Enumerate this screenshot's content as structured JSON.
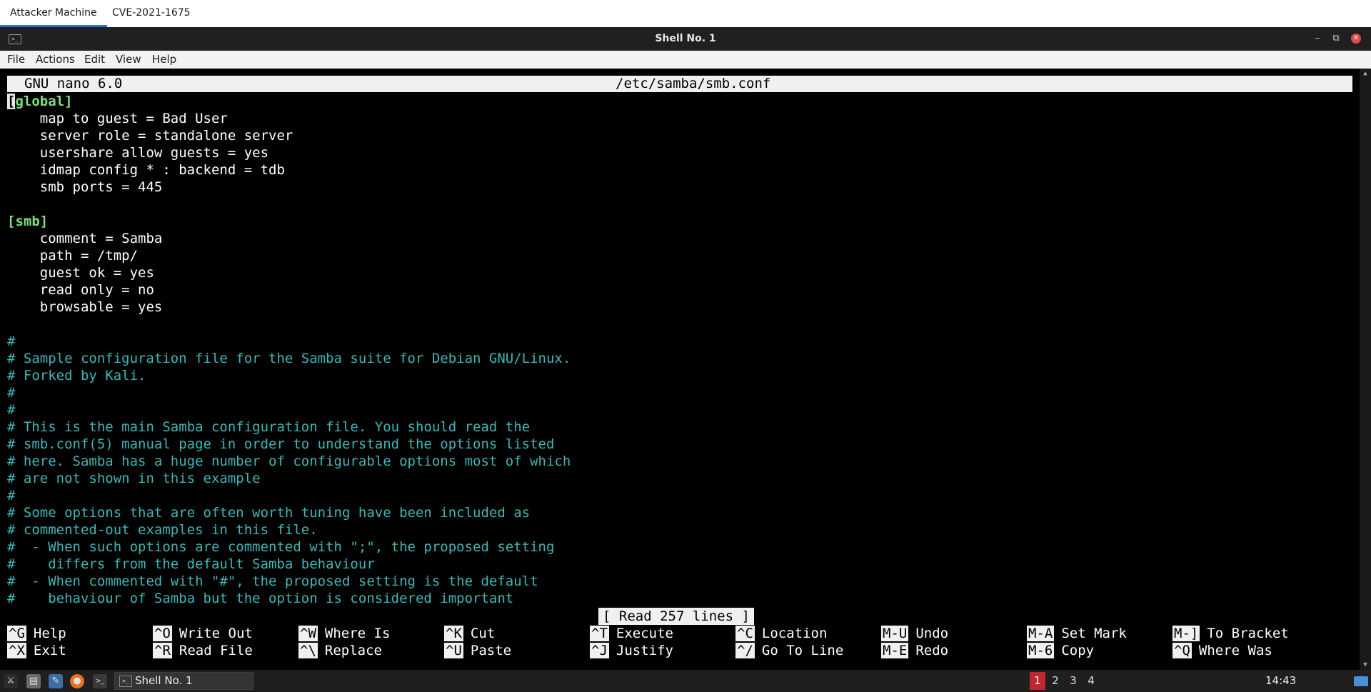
{
  "top_tabs": [
    {
      "label": "Attacker Machine",
      "active": true
    },
    {
      "label": "CVE-2021-1675",
      "active": false
    }
  ],
  "window": {
    "title": "Shell No. 1",
    "icon": "terminal-icon",
    "controls": {
      "minimize": "–",
      "restore": "⧉",
      "close": "✕"
    }
  },
  "menu": [
    "File",
    "Actions",
    "Edit",
    "View",
    "Help"
  ],
  "nano": {
    "app": "GNU nano 6.0",
    "file": "/etc/samba/smb.conf",
    "status": "[ Read 257 lines ]",
    "lines": [
      {
        "text": "[global]",
        "kind": "section"
      },
      {
        "text": "    map to guest = Bad User",
        "kind": "normal"
      },
      {
        "text": "    server role = standalone server",
        "kind": "normal"
      },
      {
        "text": "    usershare allow guests = yes",
        "kind": "normal"
      },
      {
        "text": "    idmap config * : backend = tdb",
        "kind": "normal"
      },
      {
        "text": "    smb ports = 445",
        "kind": "normal"
      },
      {
        "text": "",
        "kind": "normal"
      },
      {
        "text": "[smb]",
        "kind": "section"
      },
      {
        "text": "    comment = Samba",
        "kind": "normal"
      },
      {
        "text": "    path = /tmp/",
        "kind": "normal"
      },
      {
        "text": "    guest ok = yes",
        "kind": "normal"
      },
      {
        "text": "    read only = no",
        "kind": "normal"
      },
      {
        "text": "    browsable = yes",
        "kind": "normal"
      },
      {
        "text": "",
        "kind": "normal"
      },
      {
        "text": "#",
        "kind": "comment"
      },
      {
        "text": "# Sample configuration file for the Samba suite for Debian GNU/Linux.",
        "kind": "comment"
      },
      {
        "text": "# Forked by Kali.",
        "kind": "comment"
      },
      {
        "text": "#",
        "kind": "comment"
      },
      {
        "text": "#",
        "kind": "comment"
      },
      {
        "text": "# This is the main Samba configuration file. You should read the",
        "kind": "comment"
      },
      {
        "text": "# smb.conf(5) manual page in order to understand the options listed",
        "kind": "comment"
      },
      {
        "text": "# here. Samba has a huge number of configurable options most of which",
        "kind": "comment"
      },
      {
        "text": "# are not shown in this example",
        "kind": "comment"
      },
      {
        "text": "#",
        "kind": "comment"
      },
      {
        "text": "# Some options that are often worth tuning have been included as",
        "kind": "comment"
      },
      {
        "text": "# commented-out examples in this file.",
        "kind": "comment"
      },
      {
        "text": "#  - When such options are commented with \";\", the proposed setting",
        "kind": "comment"
      },
      {
        "text": "#    differs from the default Samba behaviour",
        "kind": "comment"
      },
      {
        "text": "#  - When commented with \"#\", the proposed setting is the default",
        "kind": "comment"
      },
      {
        "text": "#    behaviour of Samba but the option is considered important",
        "kind": "comment"
      }
    ],
    "shortcuts_row1": [
      {
        "key": "^G",
        "label": "Help"
      },
      {
        "key": "^O",
        "label": "Write Out"
      },
      {
        "key": "^W",
        "label": "Where Is"
      },
      {
        "key": "^K",
        "label": "Cut"
      },
      {
        "key": "^T",
        "label": "Execute"
      },
      {
        "key": "^C",
        "label": "Location"
      },
      {
        "key": "M-U",
        "label": "Undo"
      },
      {
        "key": "M-A",
        "label": "Set Mark"
      },
      {
        "key": "M-]",
        "label": "To Bracket"
      }
    ],
    "shortcuts_row2": [
      {
        "key": "^X",
        "label": "Exit"
      },
      {
        "key": "^R",
        "label": "Read File"
      },
      {
        "key": "^\\",
        "label": "Replace"
      },
      {
        "key": "^U",
        "label": "Paste"
      },
      {
        "key": "^J",
        "label": "Justify"
      },
      {
        "key": "^/",
        "label": "Go To Line"
      },
      {
        "key": "M-E",
        "label": "Redo"
      },
      {
        "key": "M-6",
        "label": "Copy"
      },
      {
        "key": "^Q",
        "label": "Where Was"
      }
    ]
  },
  "taskbar": {
    "launchers": [
      {
        "name": "kali-menu-icon",
        "glyph": "⚔",
        "color": "#2a2a2a"
      },
      {
        "name": "file-manager-icon",
        "glyph": "▤",
        "color": "#6b6b6b"
      },
      {
        "name": "text-editor-icon",
        "glyph": "✎",
        "color": "#3a6ea5"
      },
      {
        "name": "firefox-icon",
        "glyph": "●",
        "color": "#e8711f"
      },
      {
        "name": "terminal-launcher-icon",
        "glyph": ">_",
        "color": "#3a3a3a"
      }
    ],
    "task_label": "Shell No. 1",
    "workspaces": [
      "1",
      "2",
      "3",
      "4"
    ],
    "active_workspace": "1",
    "clock": "14:43"
  }
}
